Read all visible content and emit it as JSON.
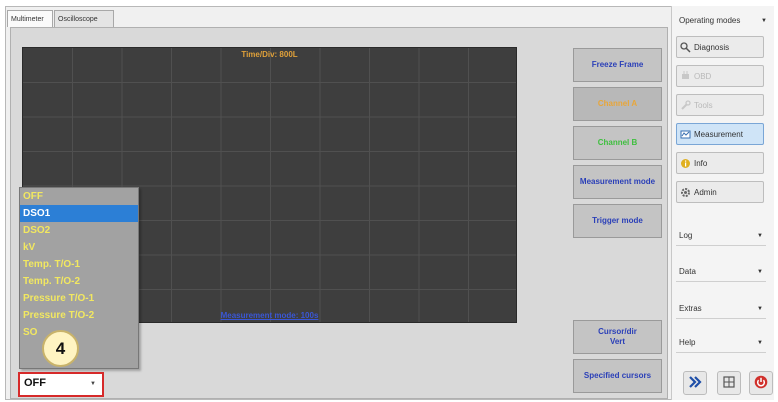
{
  "tabs": [
    {
      "label": "Multimeter"
    },
    {
      "label": "Oscilloscope"
    }
  ],
  "screen": {
    "top_label": "Time/Div: 800L",
    "bottom_label": "Measurement mode: 100s"
  },
  "right_buttons": {
    "freeze": "Freeze Frame",
    "channel_a": "Channel A",
    "channel_b": "Channel B",
    "measurement_mode": "Measurement mode",
    "trigger_mode": "Trigger mode",
    "cursor_line1": "Cursor/dir",
    "cursor_line2": "Vert",
    "specified_cursors": "Specified cursors"
  },
  "dropdown": {
    "options": [
      "OFF",
      "DSO1",
      "DSO2",
      "kV",
      "Temp. T/O-1",
      "Temp. T/O-2",
      "Pressure T/O-1",
      "Pressure T/O-2",
      "SO"
    ],
    "selected_index": 1,
    "current_value": "OFF",
    "callout_number": "4"
  },
  "sidebar": {
    "operating_modes": "Operating modes",
    "buttons": [
      "Diagnosis",
      "OBD",
      "Tools",
      "Measurement",
      "Info",
      "Admin"
    ],
    "dropdowns": [
      "Log",
      "Data",
      "Extras",
      "Help"
    ]
  },
  "colors": {
    "screen_bg": "#3e3e3e",
    "grid": "#505050",
    "channel_a": "#e8a63a",
    "channel_b": "#3fbf3f",
    "button_text_blue": "#2a3fb8",
    "dropdown_text": "#f2e860",
    "selection": "#2c7fd6"
  },
  "icons": {
    "diagnosis": "stethoscope-icon",
    "obd": "plug-icon",
    "tools": "wrench-icon",
    "measurement": "meter-icon",
    "info": "info-icon",
    "admin": "gear-icon",
    "forward": "double-chevron-right-icon",
    "grid": "grid-icon",
    "power": "power-icon"
  }
}
